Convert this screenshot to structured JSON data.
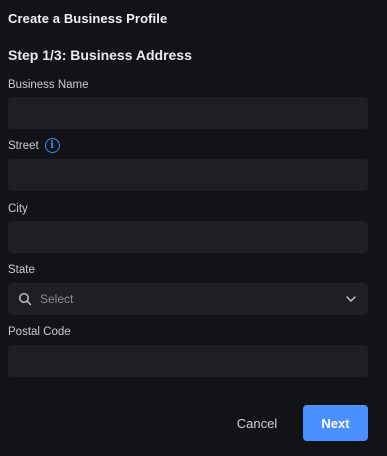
{
  "dialog": {
    "title": "Create a Business Profile",
    "step": "Step 1/3: Business Address"
  },
  "fields": {
    "business_name": {
      "label": "Business Name",
      "value": ""
    },
    "street": {
      "label": "Street",
      "value": "",
      "info_icon": "info-icon"
    },
    "city": {
      "label": "City",
      "value": ""
    },
    "state": {
      "label": "State",
      "placeholder": "Select",
      "icon": "search-icon",
      "chevron": "chevron-down-icon"
    },
    "postal_code": {
      "label": "Postal Code",
      "value": ""
    }
  },
  "actions": {
    "cancel_label": "Cancel",
    "next_label": "Next"
  },
  "colors": {
    "background": "#121316",
    "field_background": "#1e1f23",
    "accent": "#4a90ff",
    "info_icon": "#3b8cff"
  }
}
